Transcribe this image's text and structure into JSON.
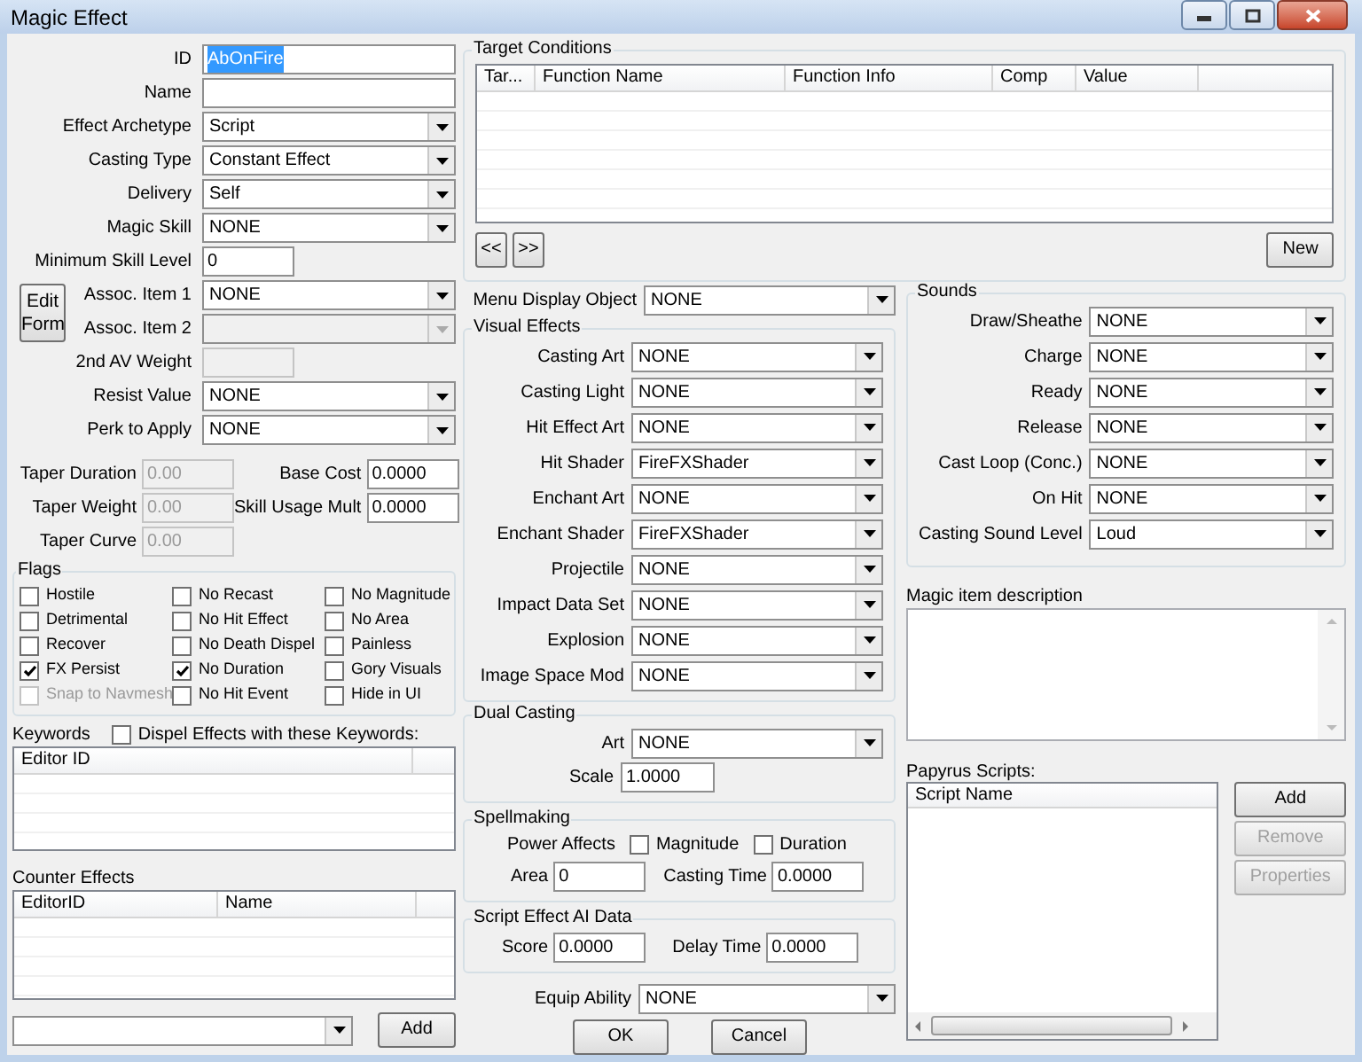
{
  "window": {
    "title": "Magic Effect"
  },
  "form_top": [
    {
      "kind": "text",
      "label": "ID",
      "value": "AbOnFire",
      "highlighted": true,
      "disabled": false
    },
    {
      "kind": "text",
      "label": "Name",
      "disabled": false
    },
    {
      "kind": "combo",
      "label": "Effect Archetype",
      "value": "Script",
      "disabled": false
    },
    {
      "kind": "combo",
      "label": "Casting Type",
      "value": "Constant Effect",
      "disabled": false
    },
    {
      "kind": "combo",
      "label": "Delivery",
      "value": "Self",
      "disabled": false
    },
    {
      "kind": "combo",
      "label": "Magic Skill",
      "value": "NONE",
      "disabled": false
    },
    {
      "kind": "short",
      "label": "Minimum Skill Level",
      "value": "0",
      "disabled": false
    }
  ],
  "edit_form_button": "Edit Form",
  "assoc_fields": [
    {
      "kind": "combo",
      "label": "Assoc. Item 1",
      "value": "NONE",
      "disabled": false
    },
    {
      "kind": "combo",
      "label": "Assoc. Item 2",
      "disabled": true
    },
    {
      "kind": "short",
      "label": "2nd AV Weight",
      "disabled": true
    }
  ],
  "form_bottom": [
    {
      "kind": "combo",
      "label": "Resist Value",
      "value": "NONE",
      "disabled": false
    },
    {
      "kind": "combo",
      "label": "Perk to Apply",
      "value": "NONE",
      "disabled": false
    }
  ],
  "taper_fields": [
    {
      "label": "Taper Duration",
      "value": "0.00",
      "disabled": true
    },
    {
      "label": "Taper Weight",
      "value": "0.00",
      "disabled": true
    },
    {
      "label": "Taper Curve",
      "value": "0.00",
      "disabled": true
    }
  ],
  "cost_fields": [
    {
      "label": "Base Cost",
      "value": "0.0000",
      "disabled": false
    },
    {
      "label": "Skill Usage Mult",
      "value": "0.0000",
      "disabled": false
    }
  ],
  "flags": {
    "title": "Flags",
    "items": [
      {
        "label": "Hostile",
        "checked": false,
        "disabled": false
      },
      {
        "label": "No Recast",
        "checked": false,
        "disabled": false
      },
      {
        "label": "No Magnitude",
        "checked": false,
        "disabled": false
      },
      {
        "label": "Detrimental",
        "checked": false,
        "disabled": false
      },
      {
        "label": "No Hit Effect",
        "checked": false,
        "disabled": false
      },
      {
        "label": "No Area",
        "checked": false,
        "disabled": false
      },
      {
        "label": "Recover",
        "checked": false,
        "disabled": false
      },
      {
        "label": "No Death Dispel",
        "checked": false,
        "disabled": false
      },
      {
        "label": "Painless",
        "checked": false,
        "disabled": false
      },
      {
        "label": "FX Persist",
        "checked": true,
        "disabled": false
      },
      {
        "label": "No Duration",
        "checked": true,
        "disabled": false
      },
      {
        "label": "Gory Visuals",
        "checked": false,
        "disabled": false
      },
      {
        "label": "Snap to Navmesh",
        "checked": false,
        "disabled": true
      },
      {
        "label": "No Hit Event",
        "checked": false,
        "disabled": false
      },
      {
        "label": "Hide in UI",
        "checked": false,
        "disabled": false
      }
    ]
  },
  "keywords": {
    "title": "Keywords",
    "dispel": {
      "label": "Dispel Effects with these Keywords:",
      "checked": false
    },
    "columns": [
      "Editor ID"
    ]
  },
  "counter_effects": {
    "title": "Counter Effects",
    "columns": [
      "EditorID",
      "Name"
    ],
    "add_button": "Add"
  },
  "target_conditions": {
    "title": "Target Conditions",
    "columns": [
      "Tar...",
      "Function Name",
      "Function Info",
      "Comp",
      "Value"
    ],
    "prev_button": "<<",
    "next_button": ">>",
    "new_button": "New"
  },
  "menu_display_object": {
    "label": "Menu Display Object",
    "value": "NONE"
  },
  "visual_effects": {
    "title": "Visual Effects",
    "items": [
      {
        "label": "Casting Art",
        "value": "NONE"
      },
      {
        "label": "Casting Light",
        "value": "NONE"
      },
      {
        "label": "Hit Effect Art",
        "value": "NONE"
      },
      {
        "label": "Hit Shader",
        "value": "FireFXShader"
      },
      {
        "label": "Enchant Art",
        "value": "NONE"
      },
      {
        "label": "Enchant Shader",
        "value": "FireFXShader"
      },
      {
        "label": "Projectile",
        "value": "NONE"
      },
      {
        "label": "Impact Data Set",
        "value": "NONE"
      },
      {
        "label": "Explosion",
        "value": "NONE"
      },
      {
        "label": "Image Space Mod",
        "value": "NONE"
      }
    ]
  },
  "dual_casting": {
    "title": "Dual Casting",
    "art_label": "Art",
    "art_value": "NONE",
    "scale_label": "Scale",
    "scale_value": "1.0000"
  },
  "spellmaking": {
    "title": "Spellmaking",
    "power_label": "Power Affects",
    "options": [
      {
        "label": "Magnitude",
        "checked": false
      },
      {
        "label": "Duration",
        "checked": false
      }
    ],
    "area_label": "Area",
    "area_value": "0",
    "time_label": "Casting Time",
    "time_value": "0.0000"
  },
  "script_ai": {
    "title": "Script Effect AI Data",
    "score_label": "Score",
    "score_value": "0.0000",
    "delay_label": "Delay Time",
    "delay_value": "0.0000"
  },
  "equip_ability": {
    "label": "Equip Ability",
    "value": "NONE"
  },
  "buttons": [
    "OK",
    "Cancel"
  ],
  "sounds": {
    "title": "Sounds",
    "items": [
      {
        "label": "Draw/Sheathe",
        "value": "NONE"
      },
      {
        "label": "Charge",
        "value": "NONE"
      },
      {
        "label": "Ready",
        "value": "NONE"
      },
      {
        "label": "Release",
        "value": "NONE"
      },
      {
        "label": "Cast Loop (Conc.)",
        "value": "NONE"
      },
      {
        "label": "On Hit",
        "value": "NONE"
      },
      {
        "label": "Casting Sound Level",
        "value": "Loud"
      }
    ]
  },
  "description": {
    "label": "Magic item description"
  },
  "papyrus": {
    "label": "Papyrus Scripts:",
    "columns": [
      "Script Name"
    ],
    "buttons": [
      {
        "label": "Add",
        "disabled": false
      },
      {
        "label": "Remove",
        "disabled": true
      },
      {
        "label": "Properties",
        "disabled": true
      }
    ]
  }
}
